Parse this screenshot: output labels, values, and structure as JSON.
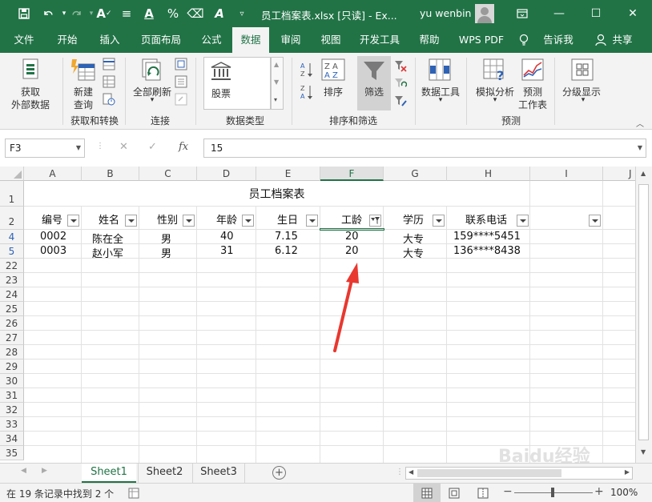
{
  "titlebar": {
    "doc_title": "员工档案表.xlsx  [只读]  -  Ex...",
    "user": "yu wenbin",
    "minimize": "—",
    "maximize": "☐",
    "close": "✕"
  },
  "tabs": [
    {
      "label": "文件"
    },
    {
      "label": "开始"
    },
    {
      "label": "插入"
    },
    {
      "label": "页面布局"
    },
    {
      "label": "公式"
    },
    {
      "label": "数据"
    },
    {
      "label": "审阅"
    },
    {
      "label": "视图"
    },
    {
      "label": "开发工具"
    },
    {
      "label": "帮助"
    },
    {
      "label": "WPS PDF"
    },
    {
      "label": "告诉我"
    },
    {
      "label": "共享"
    }
  ],
  "ribbon": {
    "get_data": "获取",
    "get_data2": "外部数据",
    "new_query": "新建",
    "new_query2": "查询",
    "refresh_all": "全部刷新",
    "stocks": "股票",
    "sort": "排序",
    "filter": "筛选",
    "data_tools": "数据工具",
    "what_if": "模拟分析",
    "forecast": "预测",
    "forecast2": "工作表",
    "outline": "分级显示",
    "group_get": "获取和转换",
    "group_connect": "连接",
    "group_datatype": "数据类型",
    "group_sortfilter": "排序和筛选",
    "group_forecast": "预测"
  },
  "formulabar": {
    "namebox": "F3",
    "formula": "15",
    "cancel": "✕",
    "enter": "✓",
    "fx": "fx"
  },
  "grid": {
    "columns": [
      "A",
      "B",
      "C",
      "D",
      "E",
      "F",
      "G",
      "H",
      "I",
      "J"
    ],
    "row_numbers": [
      "1",
      "2",
      "4",
      "5",
      "22",
      "23",
      "24",
      "25",
      "26",
      "27",
      "28",
      "29",
      "30",
      "31",
      "32",
      "33",
      "34",
      "35"
    ],
    "title": "员工档案表",
    "headers": [
      "编号",
      "姓名",
      "性别",
      "年龄",
      "生日",
      "工龄",
      "学历",
      "联系电话"
    ],
    "rows": [
      [
        "0002",
        "陈在全",
        "男",
        "40",
        "7.15",
        "20",
        "大专",
        "159****5451"
      ],
      [
        "0003",
        "赵小军",
        "男",
        "31",
        "6.12",
        "20",
        "大专",
        "136****8438"
      ]
    ],
    "selected_column": "F"
  },
  "sheets": [
    {
      "label": "Sheet1"
    },
    {
      "label": "Sheet2"
    },
    {
      "label": "Sheet3"
    }
  ],
  "statusbar": {
    "text": "在 19 条记录中找到 2 个",
    "zoom": "100%"
  },
  "watermark": "Baidu经验",
  "colors": {
    "accent": "#217346",
    "arrow": "#e8382f"
  }
}
